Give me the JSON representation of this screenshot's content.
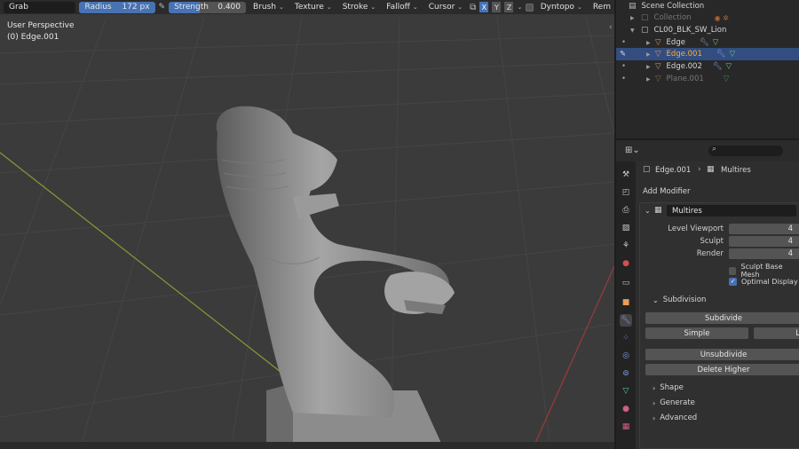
{
  "toolbar": {
    "tool": "Grab",
    "radius_label": "Radius",
    "radius_value": "172 px",
    "strength_label": "Strength",
    "strength_value": "0.400",
    "strength_fraction": 0.4,
    "menus": [
      "Brush",
      "Texture",
      "Stroke",
      "Falloff",
      "Cursor"
    ],
    "axes": [
      "X",
      "Y",
      "Z"
    ],
    "dyntopo": "Dyntopo",
    "remesh": "Rem"
  },
  "viewport": {
    "view_name": "User Perspective",
    "object_name": "(0) Edge.001"
  },
  "outliner": {
    "scene_collection": "Scene Collection",
    "items": [
      {
        "name": "Collection",
        "dim": true
      },
      {
        "name": "CL00_BLK_SW_Lion",
        "dim": false
      },
      {
        "name": "Edge",
        "dim": false
      },
      {
        "name": "Edge.001",
        "dim": false,
        "selected": true
      },
      {
        "name": "Edge.002",
        "dim": false
      },
      {
        "name": "Plane.001",
        "dim": true
      }
    ]
  },
  "properties": {
    "breadcrumb_object": "Edge.001",
    "breadcrumb_modifier": "Multires",
    "add_modifier": "Add Modifier",
    "modifier_name": "Multires",
    "level_viewport_label": "Level Viewport",
    "level_viewport_value": "4",
    "sculpt_label": "Sculpt",
    "sculpt_value": "4",
    "render_label": "Render",
    "render_value": "4",
    "sculpt_base_mesh": "Sculpt Base Mesh",
    "optimal_display": "Optimal Display",
    "subdivision_section": "Subdivision",
    "subdivide_btn": "Subdivide",
    "simple_btn": "Simple",
    "linear_btn": "L",
    "unsubdivide_btn": "Unsubdivide",
    "delete_higher_btn": "Delete Higher",
    "shape_section": "Shape",
    "generate_section": "Generate",
    "advanced_section": "Advanced"
  },
  "colors": {
    "accent": "#4772b3",
    "selected_row": "#334d80",
    "active_object": "#ffaf29"
  }
}
